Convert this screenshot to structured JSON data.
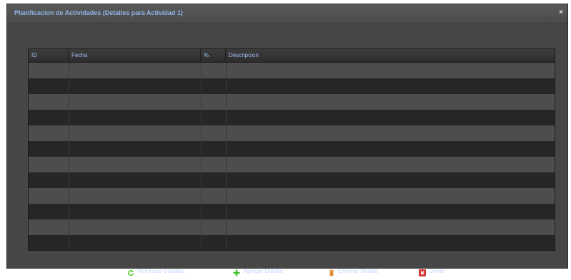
{
  "dialog": {
    "title": "Planificacion de Actividades (Detalles para Actividad 1)",
    "close_label": "×"
  },
  "grid": {
    "columns": [
      "ID",
      "Fecha",
      "%",
      "Descripcion"
    ],
    "rows": []
  },
  "footer": {
    "refresh_label": "Refrescar Detalles",
    "add_label": "Agregar Detalle",
    "delete_label": "Eliminar Detalle",
    "close_label": "Cerrar"
  },
  "colors": {
    "accent": "#8fb4e6",
    "refresh_icon": "#5fcf3a",
    "add_icon": "#3fbf2a",
    "delete_icon": "#e08a2a",
    "close_icon": "#d83030"
  },
  "icons": {
    "refresh": "refresh-icon",
    "add": "plus-icon",
    "delete": "trash-icon",
    "close": "close-icon"
  }
}
